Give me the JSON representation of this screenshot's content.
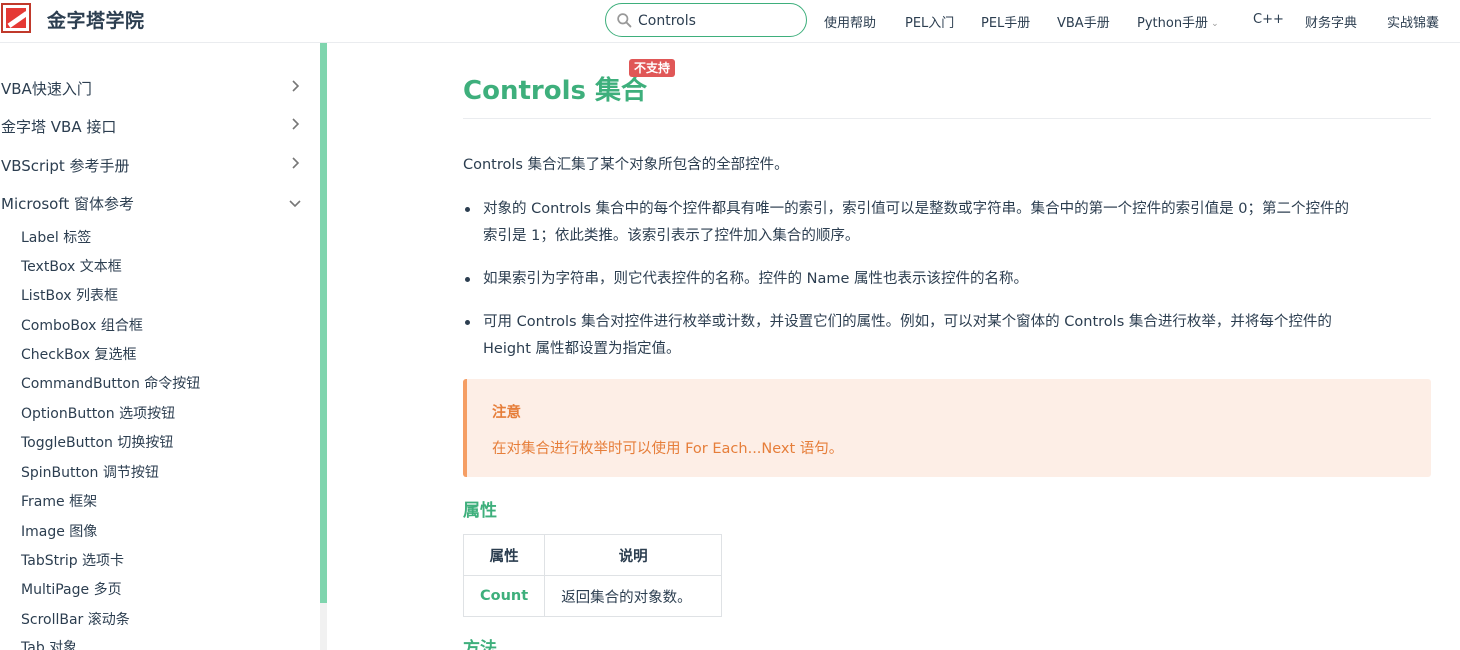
{
  "header": {
    "site_title": "金字塔学院",
    "search_value": "Controls",
    "nav": [
      {
        "label": "使用帮助"
      },
      {
        "label": "PEL入门"
      },
      {
        "label": "PEL手册"
      },
      {
        "label": "VBA手册"
      },
      {
        "label": "Python手册"
      },
      {
        "label": "C++"
      },
      {
        "label": "财务字典"
      },
      {
        "label": "实战锦囊"
      }
    ]
  },
  "sidebar": {
    "sections": [
      {
        "label": "VBA快速入门",
        "state": "collapsed"
      },
      {
        "label": "金字塔 VBA 接口",
        "state": "collapsed"
      },
      {
        "label": "VBScript 参考手册",
        "state": "collapsed"
      },
      {
        "label": "Microsoft 窗体参考",
        "state": "expanded"
      }
    ],
    "items": [
      "Label 标签",
      "TextBox 文本框",
      "ListBox 列表框",
      "ComboBox 组合框",
      "CheckBox 复选框",
      "CommandButton 命令按钮",
      "OptionButton 选项按钮",
      "ToggleButton 切换按钮",
      "SpinButton 调节按钮",
      "Frame 框架",
      "Image 图像",
      "TabStrip 选项卡",
      "MultiPage 多页",
      "ScrollBar 滚动条",
      "Tab 对象"
    ]
  },
  "main": {
    "title": "Controls 集合",
    "badge": "不支持",
    "intro": "Controls 集合汇集了某个对象所包含的全部控件。",
    "bullets": [
      {
        "line1": "对象的 Controls 集合中的每个控件都具有唯一的索引，索引值可以是整数或字符串。集合中的第一个控件的索引值是 0；第二个控件的",
        "line2": "索引是 1；依此类推。该索引表示了控件加入集合的顺序。"
      },
      {
        "line1": "如果索引为字符串，则它代表控件的名称。控件的 Name 属性也表示该控件的名称。",
        "line2": ""
      },
      {
        "line1": "可用 Controls 集合对控件进行枚举或计数，并设置它们的属性。例如，可以对某个窗体的 Controls 集合进行枚举，并将每个控件的",
        "line2": "Height 属性都设置为指定值。"
      }
    ],
    "note": {
      "title": "注意",
      "text": "在对集合进行枚举时可以使用 For Each...Next 语句。"
    },
    "properties_heading": "属性",
    "properties_table": {
      "headers": [
        "属性",
        "说明"
      ],
      "rows": [
        {
          "name": "Count",
          "desc": "返回集合的对象数。"
        }
      ]
    },
    "methods_heading": "方法"
  },
  "colors": {
    "accent": "#3eaf7c",
    "badge": "#e05757",
    "note_bg": "#fdeee6",
    "note_text": "#e67e3a"
  }
}
